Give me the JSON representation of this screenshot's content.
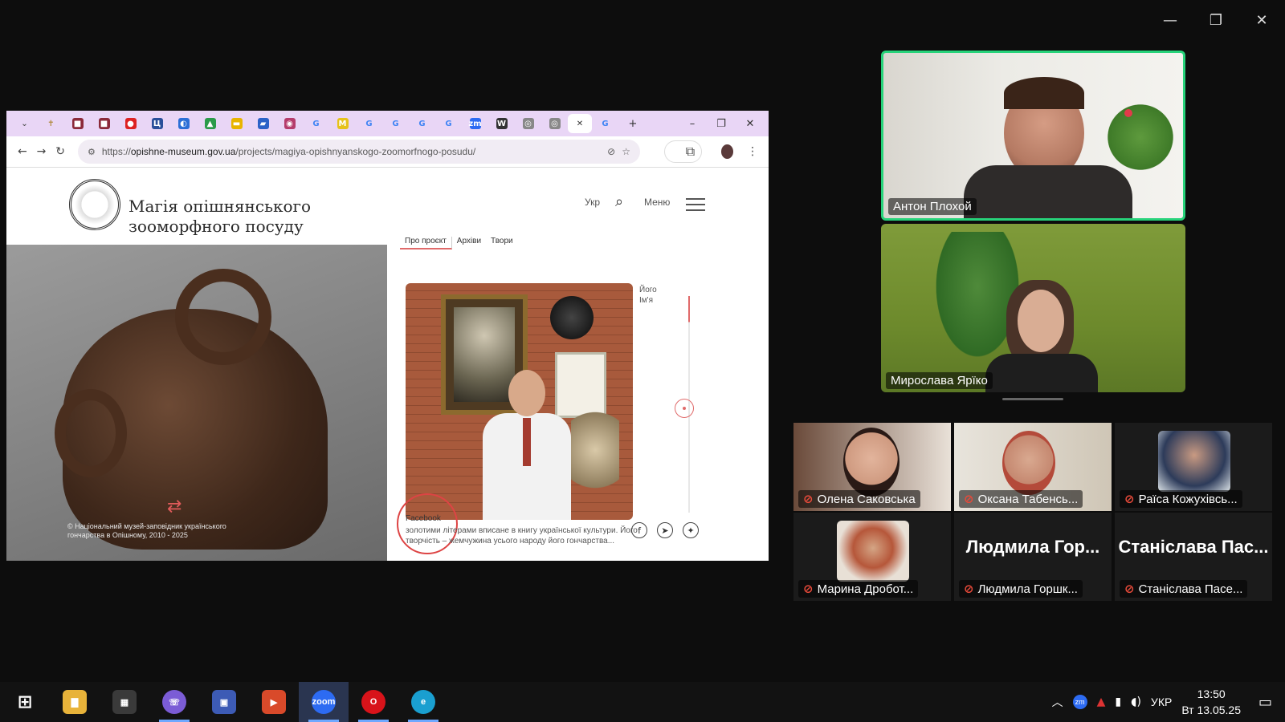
{
  "window": {
    "minimize_icon": "minimize-icon",
    "restore_icon": "restore-icon",
    "close_icon": "close-icon"
  },
  "browser": {
    "url_prefix": "https://",
    "url_host": "opishne-museum.gov.ua",
    "url_path": "/projects/magiya-opishnyanskogo-zoomorfnogo-posudu/",
    "tabs": [
      {
        "icon": "dropdown",
        "glyph": "⌄",
        "color": "#555"
      },
      {
        "icon": "cross",
        "glyph": "✝",
        "color": "#b08a3e"
      },
      {
        "icon": "site",
        "glyph": "■",
        "color": "#8b2a3a"
      },
      {
        "icon": "site",
        "glyph": "■",
        "color": "#8b2a3a"
      },
      {
        "icon": "flag-japan",
        "glyph": "●",
        "color": "#d22"
      },
      {
        "icon": "site",
        "glyph": "Ц",
        "color": "#2a4f9a"
      },
      {
        "icon": "site",
        "glyph": "◐",
        "color": "#2c6fd6"
      },
      {
        "icon": "drive",
        "glyph": "▲",
        "color": "#2b9a4a"
      },
      {
        "icon": "slides",
        "glyph": "▬",
        "color": "#e8b400"
      },
      {
        "icon": "site",
        "glyph": "▰",
        "color": "#2b62c7"
      },
      {
        "icon": "site",
        "glyph": "◉",
        "color": "#b53c6c"
      },
      {
        "icon": "google",
        "glyph": "G",
        "color": "#4285f4"
      },
      {
        "icon": "site",
        "glyph": "M",
        "color": "#e6c21a"
      },
      {
        "icon": "google",
        "glyph": "G",
        "color": "#4285f4"
      },
      {
        "icon": "google",
        "glyph": "G",
        "color": "#4285f4"
      },
      {
        "icon": "google",
        "glyph": "G",
        "color": "#4285f4"
      },
      {
        "icon": "google",
        "glyph": "G",
        "color": "#4285f4"
      },
      {
        "icon": "zoom",
        "glyph": "zm",
        "color": "#2d6bf2"
      },
      {
        "icon": "wikipedia",
        "glyph": "W",
        "color": "#333"
      },
      {
        "icon": "site",
        "glyph": "◎",
        "color": "#888"
      },
      {
        "icon": "site",
        "glyph": "◎",
        "color": "#888"
      },
      {
        "icon": "close",
        "glyph": "✕",
        "color": "#333",
        "active": true
      },
      {
        "icon": "google",
        "glyph": "G",
        "color": "#4285f4"
      }
    ],
    "new_tab": "+",
    "min": "–",
    "max": "❐",
    "close": "✕"
  },
  "site": {
    "title_line1": "Магія опішнянського",
    "title_line2": "зооморфного посуду",
    "lang": "Укр",
    "menu_label": "Меню",
    "subtabs": [
      "Про проєкт",
      "Архіви",
      "Твори"
    ],
    "hero_credit": "© Національний музей-заповідник українського гончарства в Опішному, 2010 - 2025",
    "side_label_line1": "Його",
    "side_label_line2": "Ім'я",
    "facebook": "Facebook",
    "body_line1": "золотими літерами вписане в книгу української культури. Його",
    "body_line2": "творчість – жемчужина усього народу його гончарства..."
  },
  "participants": {
    "speaker1": "Антон Плохой",
    "speaker2": "Мирослава Ярїко",
    "gallery": [
      {
        "name": "Олена Саковська",
        "muted": true
      },
      {
        "name": "Оксана Табенсь...",
        "muted": true
      },
      {
        "name": "Раїса Кожухівсь...",
        "muted": true
      },
      {
        "name": "Марина Дробот...",
        "muted": true
      },
      {
        "name": "Людмила Горшк...",
        "muted": true,
        "big": "Людмила Гор..."
      },
      {
        "name": "Станіслава Пасе...",
        "muted": true,
        "big": "Станіслава Пас..."
      }
    ]
  },
  "taskbar": {
    "apps": [
      {
        "name": "start",
        "label": "⊞",
        "color": "#121212"
      },
      {
        "name": "file-explorer",
        "label": "▇",
        "color": "#e8b33a"
      },
      {
        "name": "calculator",
        "label": "▦",
        "color": "#3a3a3a"
      },
      {
        "name": "viber",
        "label": "☏",
        "color": "#7b5cd6",
        "running": true
      },
      {
        "name": "floppy-save",
        "label": "▣",
        "color": "#3d5bb5"
      },
      {
        "name": "slides-app",
        "label": "▶",
        "color": "#d94a2a"
      },
      {
        "name": "zoom",
        "label": "zoom",
        "color": "#2d6bf2",
        "running": true,
        "active": true
      },
      {
        "name": "opera",
        "label": "O",
        "color": "#d8131a",
        "running": true
      },
      {
        "name": "edge",
        "label": "e",
        "color": "#1a9fd0",
        "running": true
      }
    ],
    "lang": "УКР",
    "time": "13:50",
    "date": "Вт 13.05.25"
  },
  "colors": {
    "active_speaker_border": "#27d37a",
    "mute_red": "#e84a3a",
    "accent_red": "#e06a6a"
  }
}
